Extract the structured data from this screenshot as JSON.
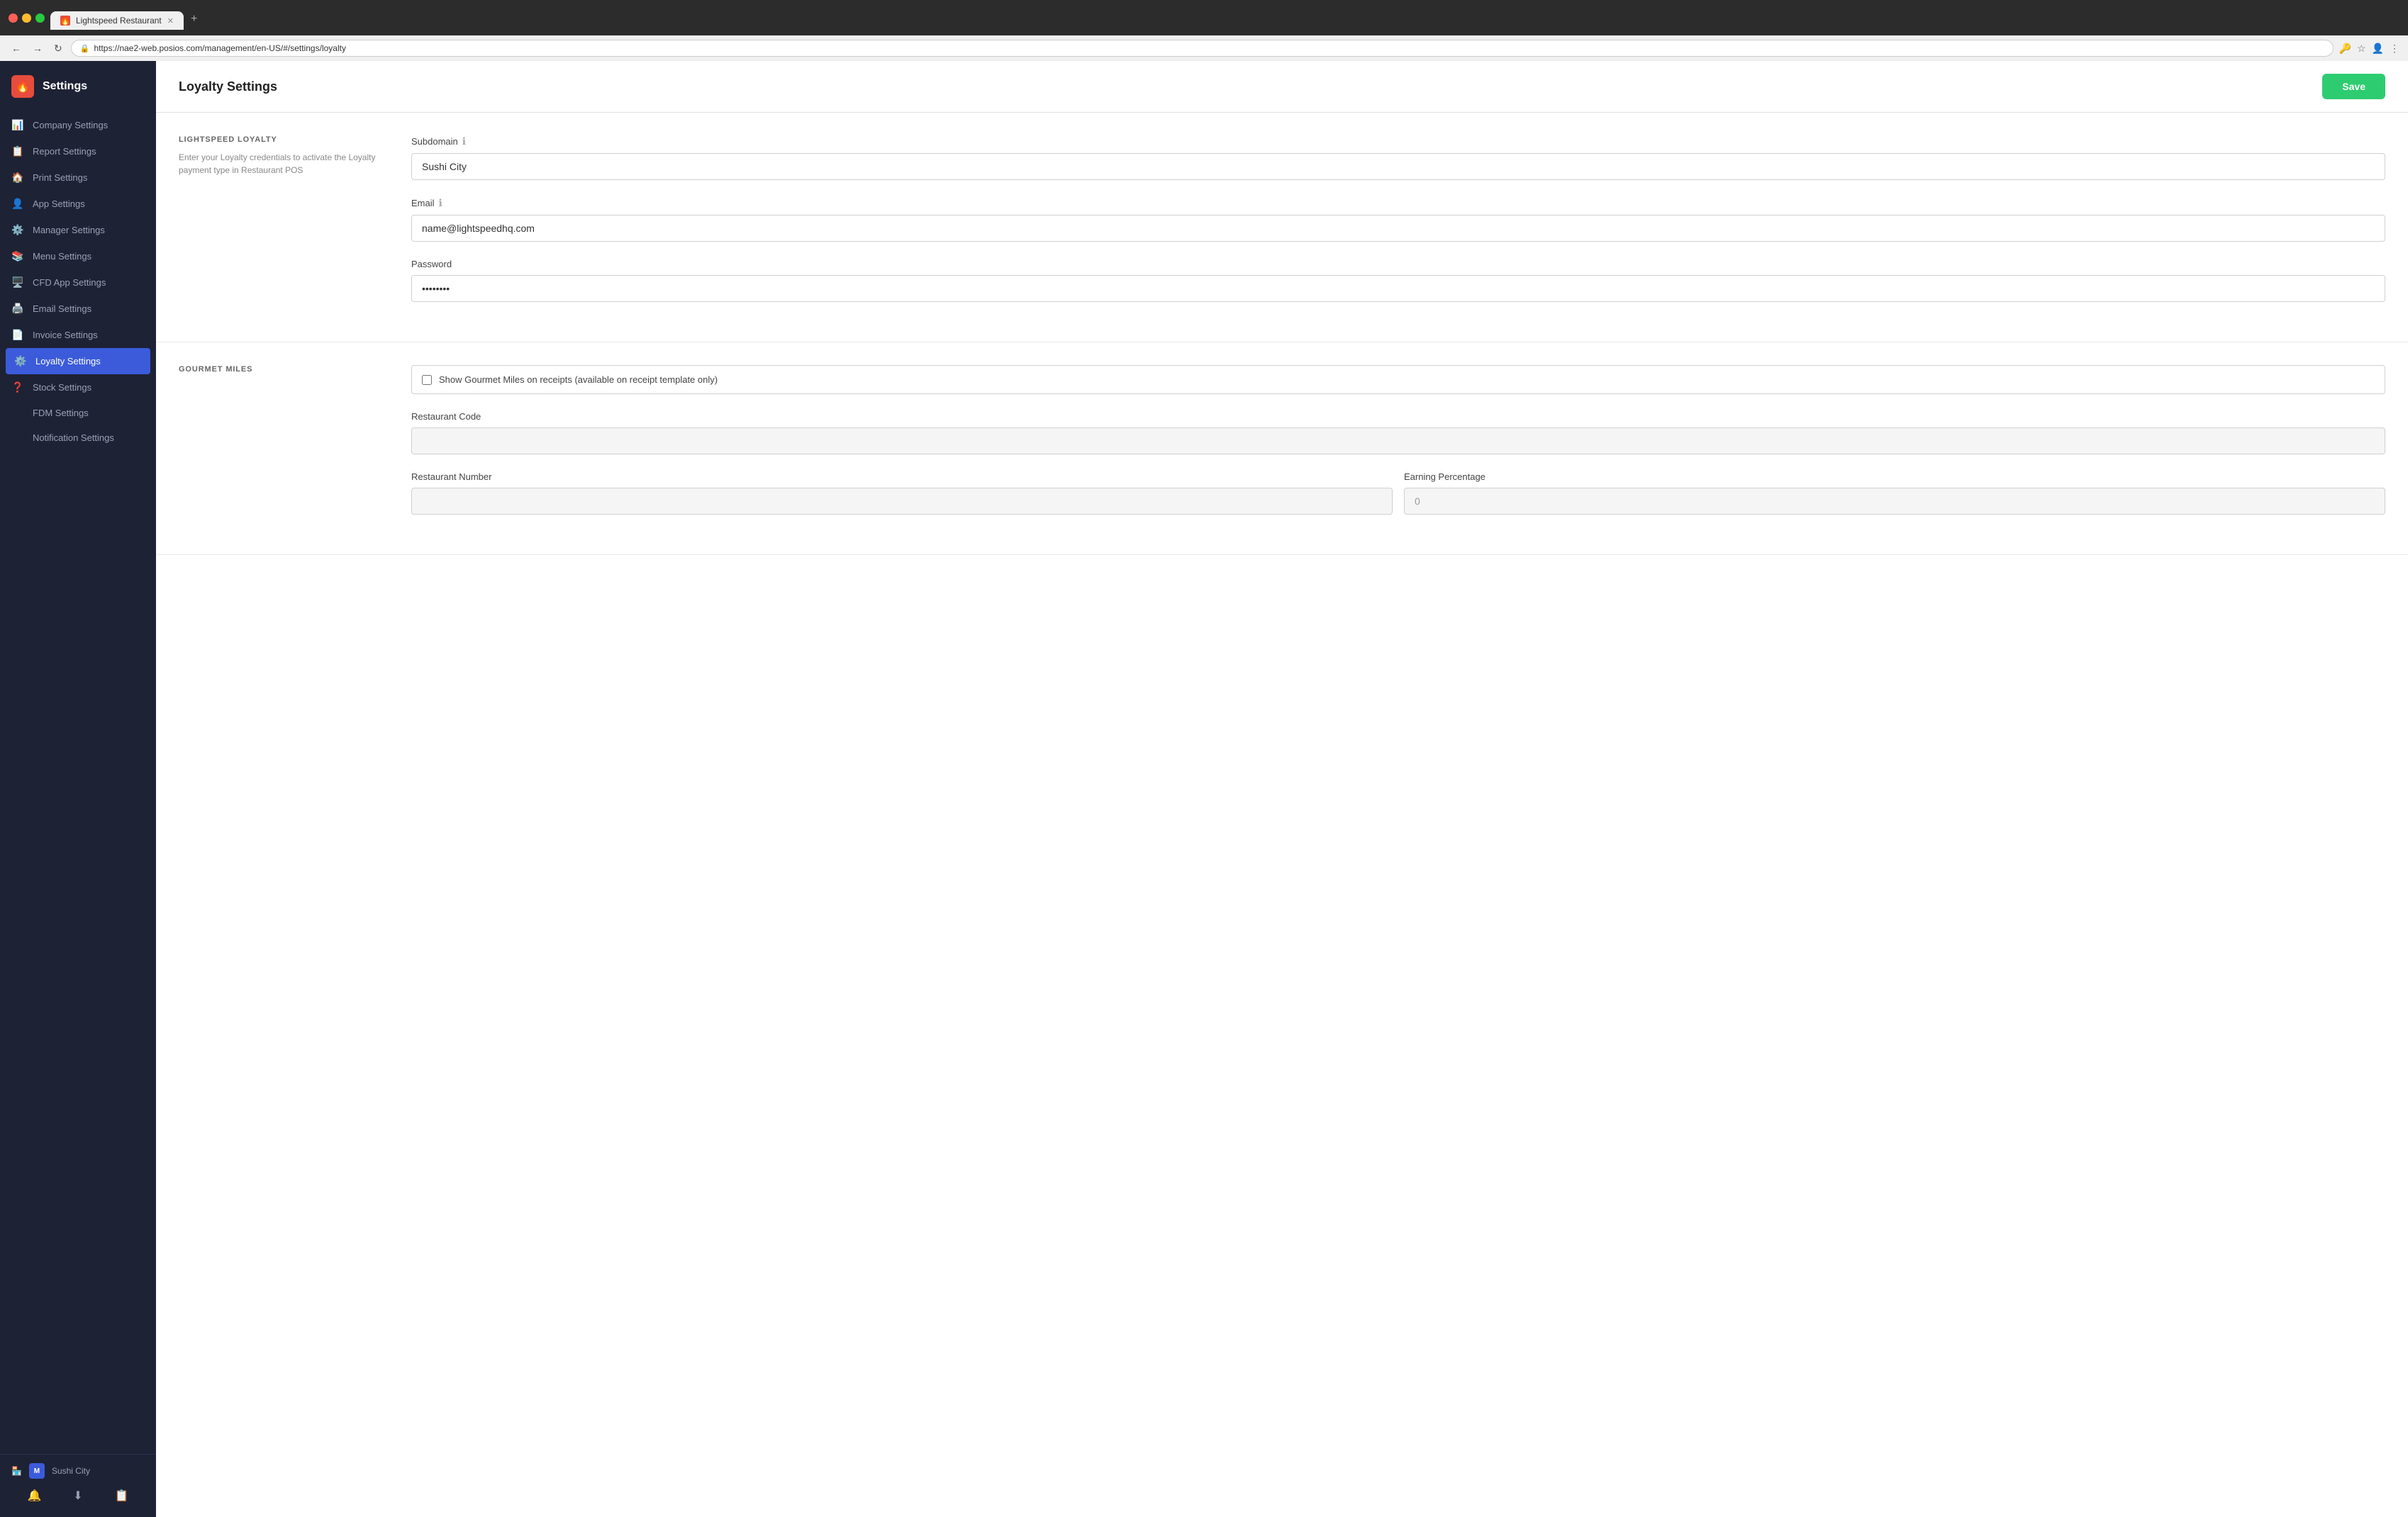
{
  "browser": {
    "url": "https://nae2-web.posios.com/management/en-US/#/settings/loyalty",
    "tab_title": "Lightspeed Restaurant",
    "tab_favicon": "🔥"
  },
  "sidebar": {
    "title": "Settings",
    "logo": "🔥",
    "items": [
      {
        "id": "company",
        "label": "Company Settings",
        "icon": "📊"
      },
      {
        "id": "report",
        "label": "Report Settings",
        "icon": "📋"
      },
      {
        "id": "print",
        "label": "Print Settings",
        "icon": "🏠"
      },
      {
        "id": "app",
        "label": "App Settings",
        "icon": "👤"
      },
      {
        "id": "manager",
        "label": "Manager Settings",
        "icon": "⚙️"
      },
      {
        "id": "menu",
        "label": "Menu Settings",
        "icon": "📚"
      },
      {
        "id": "cfd",
        "label": "CFD App Settings",
        "icon": "🖥️"
      },
      {
        "id": "email",
        "label": "Email Settings",
        "icon": "🖨️"
      },
      {
        "id": "invoice",
        "label": "Invoice Settings",
        "icon": "📄"
      },
      {
        "id": "loyalty",
        "label": "Loyalty Settings",
        "icon": "⚙️",
        "active": true
      },
      {
        "id": "stock",
        "label": "Stock Settings",
        "icon": "❓"
      },
      {
        "id": "fdm",
        "label": "FDM Settings",
        "icon": ""
      },
      {
        "id": "notification",
        "label": "Notification Settings",
        "icon": ""
      }
    ],
    "user": {
      "name": "Sushi City",
      "badge": "M"
    },
    "actions": [
      "🔔",
      "⬇",
      "📋"
    ]
  },
  "page": {
    "title": "Loyalty Settings",
    "save_label": "Save"
  },
  "sections": {
    "lightspeed_loyalty": {
      "label": "LIGHTSPEED LOYALTY",
      "description": "Enter your Loyalty credentials to activate the Loyalty payment type in Restaurant POS",
      "fields": {
        "subdomain": {
          "label": "Subdomain",
          "value": "Sushi City",
          "placeholder": ""
        },
        "email": {
          "label": "Email",
          "value": "name@lightspeedhq.com",
          "placeholder": ""
        },
        "password": {
          "label": "Password",
          "value": "••••••••",
          "placeholder": ""
        }
      }
    },
    "gourmet_miles": {
      "label": "GOURMET MILES",
      "fields": {
        "show_checkbox": {
          "label": "Show Gourmet Miles on receipts (available on receipt template only)",
          "checked": false
        },
        "restaurant_code": {
          "label": "Restaurant Code",
          "value": "",
          "placeholder": "",
          "disabled": true
        },
        "restaurant_number": {
          "label": "Restaurant Number",
          "value": "",
          "placeholder": "",
          "disabled": true
        },
        "earning_percentage": {
          "label": "Earning Percentage",
          "value": "0",
          "disabled": true
        }
      }
    }
  }
}
